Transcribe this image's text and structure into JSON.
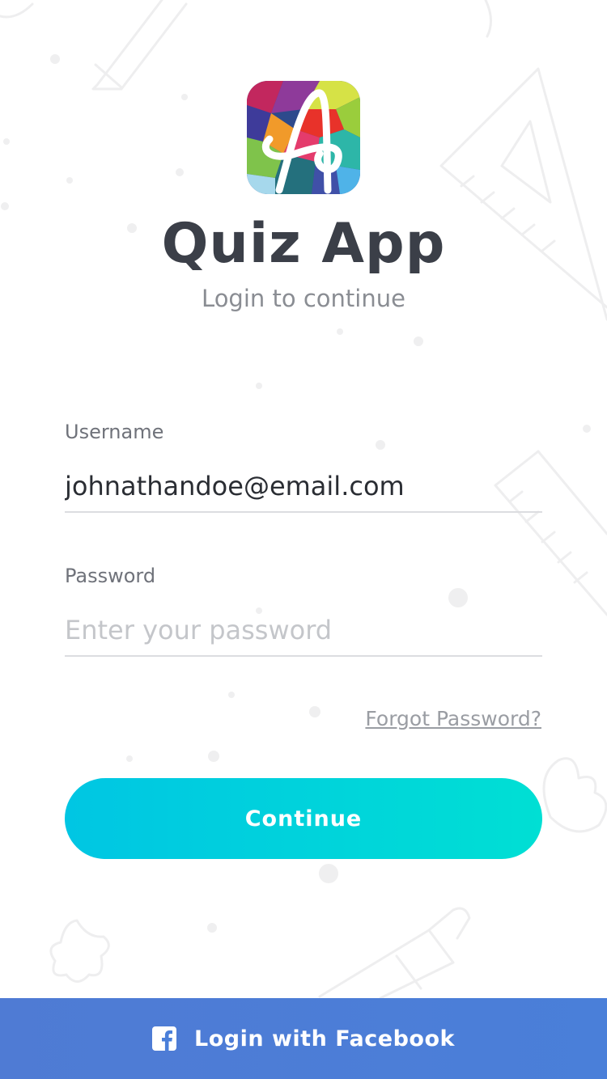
{
  "app": {
    "title": "Quiz App",
    "subtitle": "Login to continue",
    "logo_icon": "quiz-app-logo"
  },
  "form": {
    "username_label": "Username",
    "username_value": "johnathandoe@email.com",
    "password_label": "Password",
    "password_placeholder": "Enter your password",
    "password_value": "",
    "forgot_label": "Forgot Password?",
    "continue_label": "Continue"
  },
  "social": {
    "facebook_label": "Login with Facebook",
    "facebook_icon": "facebook-icon"
  },
  "colors": {
    "accent_start": "#00c6e3",
    "accent_end": "#00dfd4",
    "facebook": "#4a7fd9",
    "title": "#3b3f48"
  }
}
